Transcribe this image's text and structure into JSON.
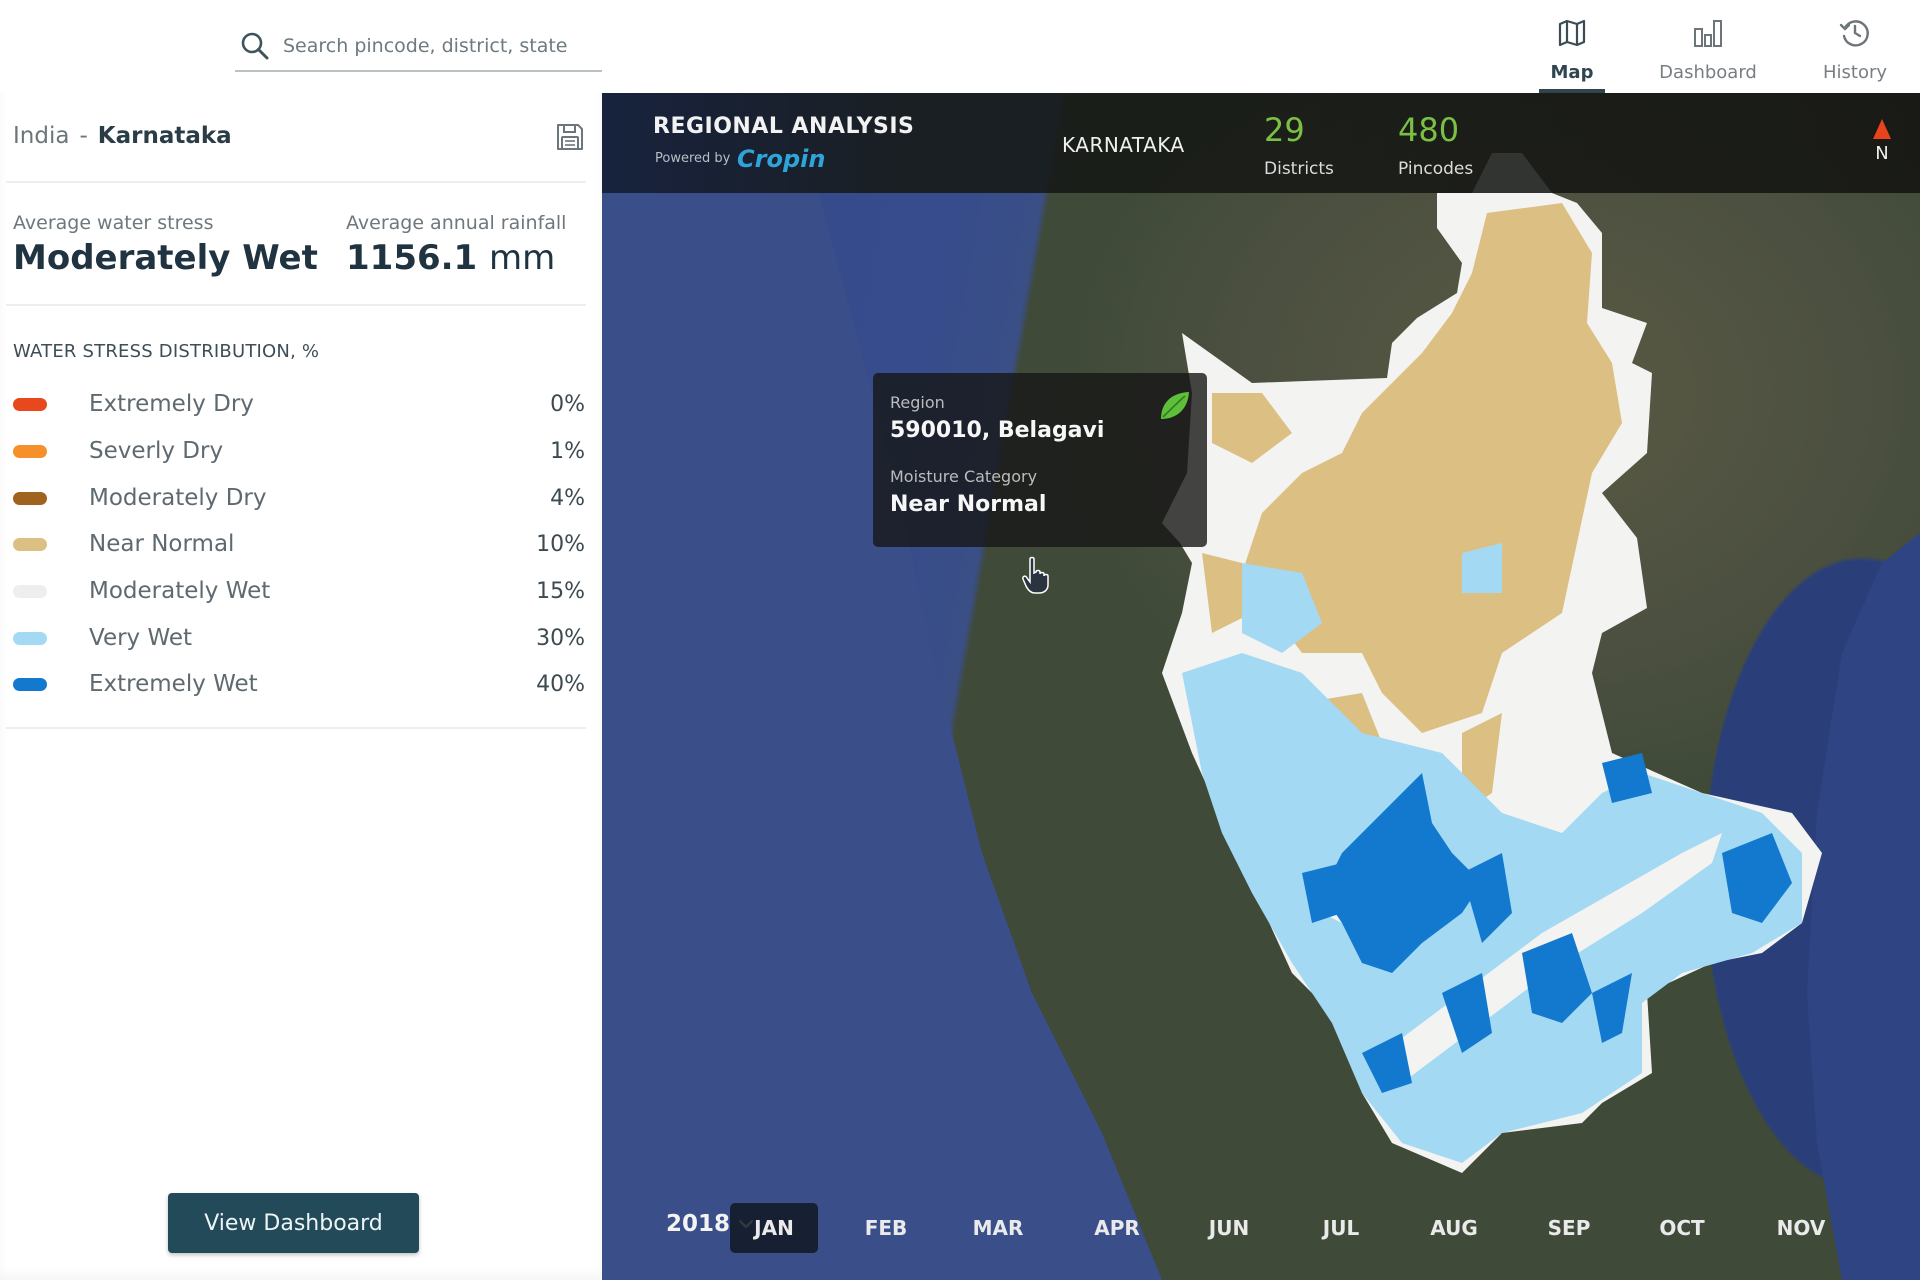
{
  "search": {
    "placeholder": "Search pincode, district, state",
    "icon": "search-icon"
  },
  "nav": {
    "items": [
      {
        "label": "Map",
        "icon": "map-icon",
        "active": true
      },
      {
        "label": "Dashboard",
        "icon": "bar-chart-icon",
        "active": false
      },
      {
        "label": "History",
        "icon": "history-icon",
        "active": false
      }
    ]
  },
  "panel": {
    "breadcrumb": {
      "country": "India",
      "separator": "-",
      "state": "Karnataka"
    },
    "save_icon": "save-icon",
    "stats": {
      "water_stress_label": "Average water stress",
      "water_stress_value": "Moderately Wet",
      "rainfall_label": "Average annual rainfall",
      "rainfall_value": "1156.1",
      "rainfall_unit": "mm"
    },
    "distribution_title": "WATER STRESS DISTRIBUTION, %",
    "distribution": [
      {
        "label": "Extremely Dry",
        "percent": "0%",
        "color": "#e8481c"
      },
      {
        "label": "Severly Dry",
        "percent": "1%",
        "color": "#f5902a"
      },
      {
        "label": "Moderately Dry",
        "percent": "4%",
        "color": "#a0621f"
      },
      {
        "label": "Near Normal",
        "percent": "10%",
        "color": "#dcbf82"
      },
      {
        "label": "Moderately Wet",
        "percent": "15%",
        "color": "#eeeeee"
      },
      {
        "label": "Very Wet",
        "percent": "30%",
        "color": "#a4d9f3"
      },
      {
        "label": "Extremely Wet",
        "percent": "40%",
        "color": "#1379cf"
      }
    ],
    "view_dashboard_label": "View Dashboard"
  },
  "map": {
    "header": {
      "title": "REGIONAL ANALYSIS",
      "powered_by": "Powered by",
      "brand": "Cropin",
      "state": "KARNATAKA",
      "districts_count": "29",
      "districts_label": "Districts",
      "pincodes_count": "480",
      "pincodes_label": "Pincodes",
      "north_label": "N"
    },
    "tooltip": {
      "region_label": "Region",
      "region_value": "590010, Belagavi",
      "category_label": "Moisture Category",
      "category_value": "Near Normal"
    },
    "timeline": {
      "year": "2018",
      "months": [
        "JAN",
        "FEB",
        "MAR",
        "APR",
        "JUN",
        "JUL",
        "AUG",
        "SEP",
        "OCT",
        "NOV"
      ],
      "active_month": "JAN"
    }
  }
}
